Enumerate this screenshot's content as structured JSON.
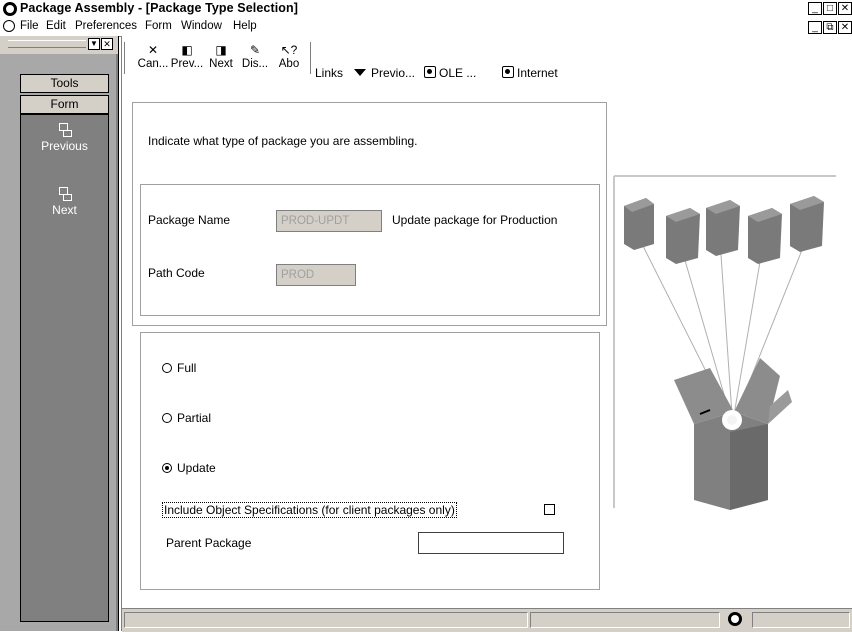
{
  "window": {
    "title": "Package Assembly - [Package Type Selection]"
  },
  "menubar": {
    "items": [
      "File",
      "Edit",
      "Preferences",
      "Form",
      "Window",
      "Help"
    ]
  },
  "leftpane": {
    "tools_label": "Tools",
    "form_label": "Form",
    "items": [
      "Previous",
      "Next"
    ]
  },
  "toolbar": {
    "buttons": [
      {
        "label": "Can...",
        "icon": "close-icon"
      },
      {
        "label": "Prev...",
        "icon": "previous-icon"
      },
      {
        "label": "Next",
        "icon": "next-icon"
      },
      {
        "label": "Dis...",
        "icon": "display-icon"
      },
      {
        "label": "Abo",
        "icon": "about-icon"
      }
    ],
    "links_label": "Links",
    "link_items": [
      "Previo...",
      "OLE ...",
      "Internet"
    ]
  },
  "form": {
    "instruction": "Indicate what type of package you are assembling.",
    "package_name_label": "Package Name",
    "package_name_value": "PROD-UPDT",
    "package_description": "Update package for Production",
    "path_code_label": "Path Code",
    "path_code_value": "PROD",
    "radio_full": "Full",
    "radio_partial": "Partial",
    "radio_update": "Update",
    "selected_type": "Update",
    "include_specs_label": "Include Object Specifications (for client packages only)",
    "include_specs_checked": false,
    "parent_package_label": "Parent Package",
    "parent_package_value": ""
  }
}
